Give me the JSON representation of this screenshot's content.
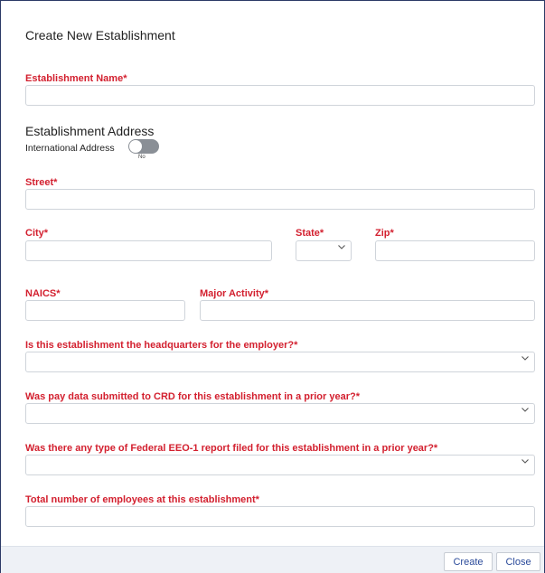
{
  "dialog": {
    "title": "Create New Establishment"
  },
  "fields": {
    "establishment_name_label": "Establishment Name*",
    "address_section": "Establishment Address",
    "international_label": "International Address",
    "international_toggle_state": "No",
    "street_label": "Street*",
    "city_label": "City*",
    "state_label": "State*",
    "zip_label": "Zip*",
    "naics_label": "NAICS*",
    "major_activity_label": "Major Activity*",
    "headquarters_label": "Is this establishment the headquarters for the employer?*",
    "pay_data_label": "Was pay data submitted to CRD for this establishment in a prior year?*",
    "eeo1_label": "Was there any type of Federal EEO-1 report filed for this establishment in a prior year?*",
    "total_employees_label": "Total number of employees at this establishment*"
  },
  "icons": {
    "select_chevron": "chevron-down-icon"
  },
  "footer": {
    "create_label": "Create",
    "close_label": "Close"
  },
  "colors": {
    "required_label": "#d3202f",
    "toggle_off": "#8a8f96",
    "footer_bg": "#eef1f6",
    "button_text": "#2a4a9a"
  }
}
